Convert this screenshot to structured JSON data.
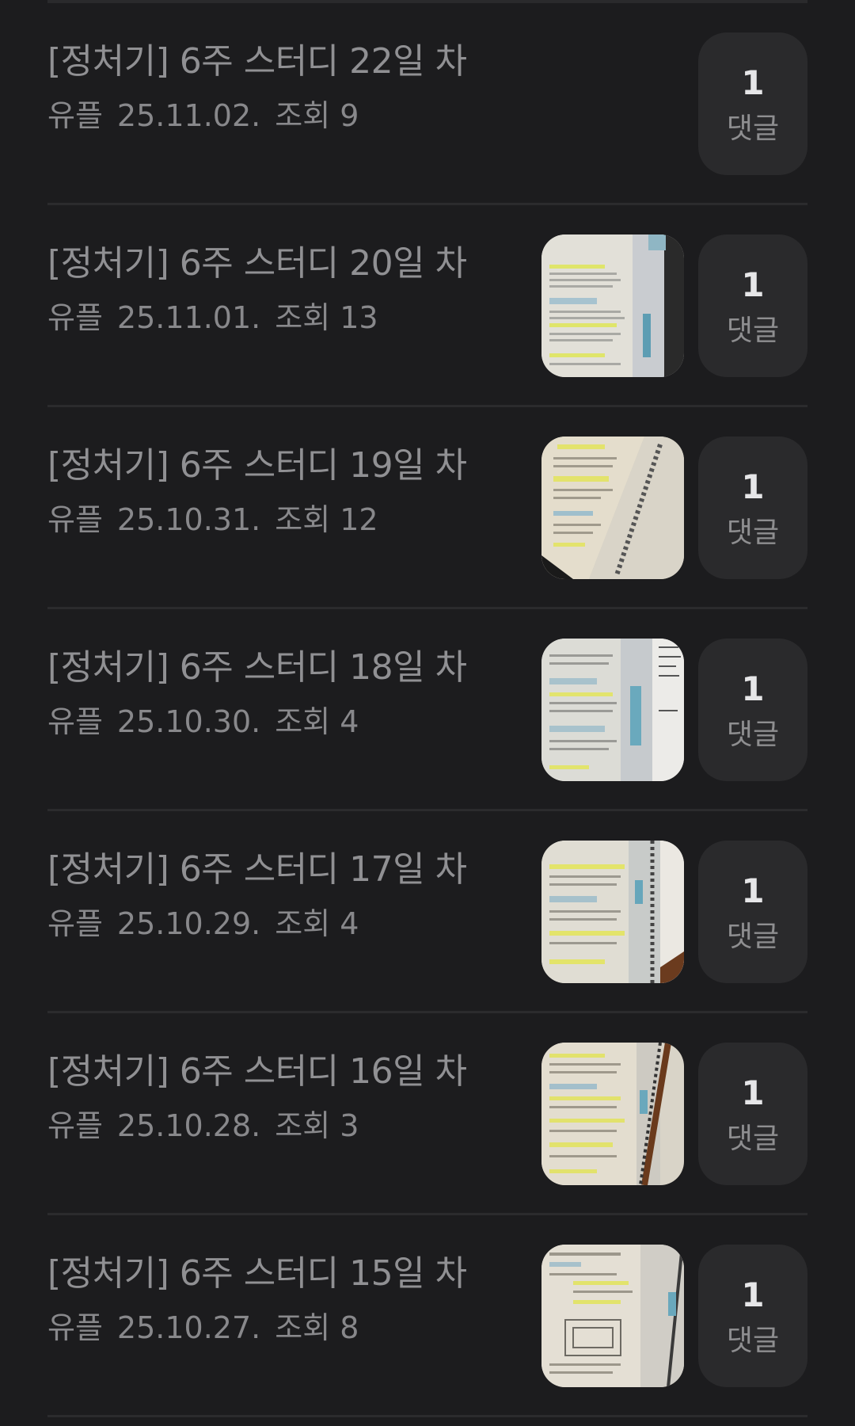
{
  "posts": [
    {
      "title": "[정처기] 6주 스터디 22일 차",
      "author": "유플",
      "date": "25.11.02.",
      "views": "조회 9",
      "comments": "1",
      "comments_label": "댓글",
      "has_thumb": false
    },
    {
      "title": "[정처기] 6주 스터디 20일 차",
      "author": "유플",
      "date": "25.11.01.",
      "views": "조회 13",
      "comments": "1",
      "comments_label": "댓글",
      "has_thumb": true
    },
    {
      "title": "[정처기] 6주 스터디 19일 차",
      "author": "유플",
      "date": "25.10.31.",
      "views": "조회 12",
      "comments": "1",
      "comments_label": "댓글",
      "has_thumb": true
    },
    {
      "title": "[정처기] 6주 스터디 18일 차",
      "author": "유플",
      "date": "25.10.30.",
      "views": "조회 4",
      "comments": "1",
      "comments_label": "댓글",
      "has_thumb": true
    },
    {
      "title": "[정처기] 6주 스터디 17일 차",
      "author": "유플",
      "date": "25.10.29.",
      "views": "조회 4",
      "comments": "1",
      "comments_label": "댓글",
      "has_thumb": true
    },
    {
      "title": "[정처기] 6주 스터디 16일 차",
      "author": "유플",
      "date": "25.10.28.",
      "views": "조회 3",
      "comments": "1",
      "comments_label": "댓글",
      "has_thumb": true
    },
    {
      "title": "[정처기] 6주 스터디 15일 차",
      "author": "유플",
      "date": "25.10.27.",
      "views": "조회 8",
      "comments": "1",
      "comments_label": "댓글",
      "has_thumb": true
    }
  ]
}
